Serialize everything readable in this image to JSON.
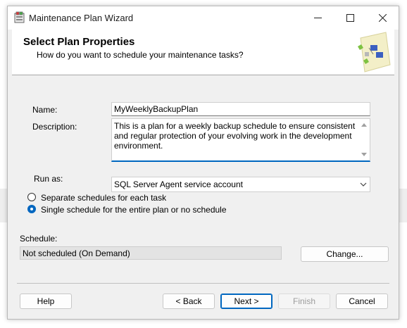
{
  "window": {
    "title": "Maintenance Plan Wizard"
  },
  "header": {
    "title": "Select Plan Properties",
    "subtitle": "How do you want to schedule your maintenance tasks?"
  },
  "form": {
    "name_label": "Name:",
    "name_value": "MyWeeklyBackupPlan",
    "description_label": "Description:",
    "description_value": "This is a plan for a weekly backup schedule to ensure consistent and regular protection of your evolving work in the development environment.",
    "run_as_label": "Run as:",
    "run_as_value": "SQL Server Agent service account",
    "radio_separate_label": "Separate schedules for each task",
    "radio_single_label": "Single schedule for the entire plan or no schedule",
    "selected_schedule_mode": "single",
    "schedule_label": "Schedule:",
    "schedule_value": "Not scheduled (On Demand)",
    "change_button": "Change..."
  },
  "buttons": {
    "help": "Help",
    "back": "< Back",
    "next": "Next >",
    "finish": "Finish",
    "cancel": "Cancel"
  },
  "colors": {
    "accent": "#0067c0",
    "dialog_bg": "#f0f0f0"
  }
}
